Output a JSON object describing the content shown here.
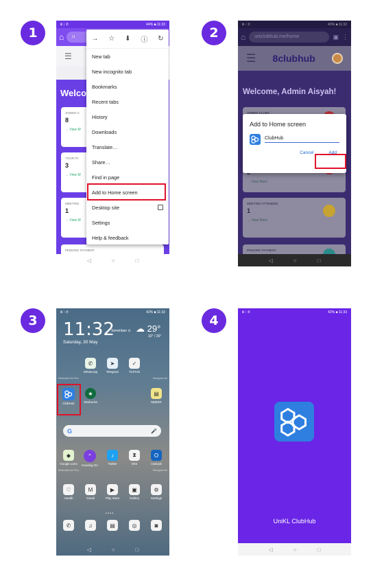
{
  "steps": [
    "1",
    "2",
    "3",
    "4"
  ],
  "status": {
    "left": "Ⅲ ⁝ ✆",
    "p1_right": "44% ■ 11:33",
    "p2_right": "43% ■ 11:32",
    "p3_right": "42% ■ 11:32",
    "p4_right": "42% ■ 11:33"
  },
  "nav": {
    "back": "◁",
    "home": "○",
    "recent": "□"
  },
  "phone1": {
    "url_text": "u",
    "welcome": "Welco",
    "cards": [
      {
        "label": "JOINED C",
        "value": "8",
        "link": "→ View M"
      },
      {
        "label": "YOUR PA",
        "value": "3",
        "link": "→ View M"
      },
      {
        "label": "MEETING",
        "value": "1",
        "link": "→ View M"
      },
      {
        "label": "PENDING PAYMENT",
        "value": "",
        "link": ""
      }
    ],
    "menu_icons": [
      "→",
      "☆",
      "⬇",
      "ⓘ",
      "↻"
    ],
    "menu_items": [
      "New tab",
      "New incognito tab",
      "Bookmarks",
      "Recent tabs",
      "History",
      "Downloads",
      "Translate…",
      "Share…",
      "Find in page",
      "Add to Home screen",
      "Desktop site",
      "Settings",
      "Help & feedback"
    ]
  },
  "phone2": {
    "url": "uniclubhub.me/home",
    "logo": "8clubhub",
    "welcome": "Welcome, Admin Aisyah!",
    "cards": [
      {
        "label": "JOINED CLUBS",
        "value": "",
        "link": ""
      },
      {
        "label": "",
        "value": "3",
        "link": "→ View More"
      },
      {
        "label": "MEETING ATTENDED",
        "value": "1",
        "link": "→ View More"
      },
      {
        "label": "PENDING PAYMENT",
        "value": "",
        "link": ""
      }
    ],
    "dialog": {
      "title": "Add to Home screen",
      "app_name": "ClubHub",
      "cancel": "Cancel",
      "add": "Add"
    },
    "colors": {
      "red": "#b8303a",
      "yellow": "#c7a331",
      "teal": "#2b8b8b"
    }
  },
  "phone3": {
    "time": "11:32",
    "location": "Seremban ⊙",
    "date": "Saturday, 30 May",
    "temp": "☁ 29°",
    "range": "32° / 26°",
    "top_apps": [
      "WhatsApp",
      "Telegram",
      "TickTick"
    ],
    "row2_apps": [
      "ClubHub",
      "Starbucks",
      "",
      "MyBSR"
    ],
    "dock_apps": [
      "Google Lens",
      "Housing Go",
      "Twitter",
      "Ohe",
      "Outlook"
    ],
    "bottom_apps": [
      "Health",
      "Gmail",
      "Play Store",
      "Gallery",
      "Settings"
    ],
    "search_g": "G",
    "search_mic": "🎤",
    "tiny_left": "Minimalist Life Plus",
    "tiny_right": "Shanghai Life"
  },
  "phone4": {
    "title": "UniKL ClubHub"
  },
  "colors": {
    "badge": "#6a2ae0",
    "highlight": "#e0112b",
    "purple": "#6a25e6",
    "brand_blue": "#2e7fe0"
  }
}
